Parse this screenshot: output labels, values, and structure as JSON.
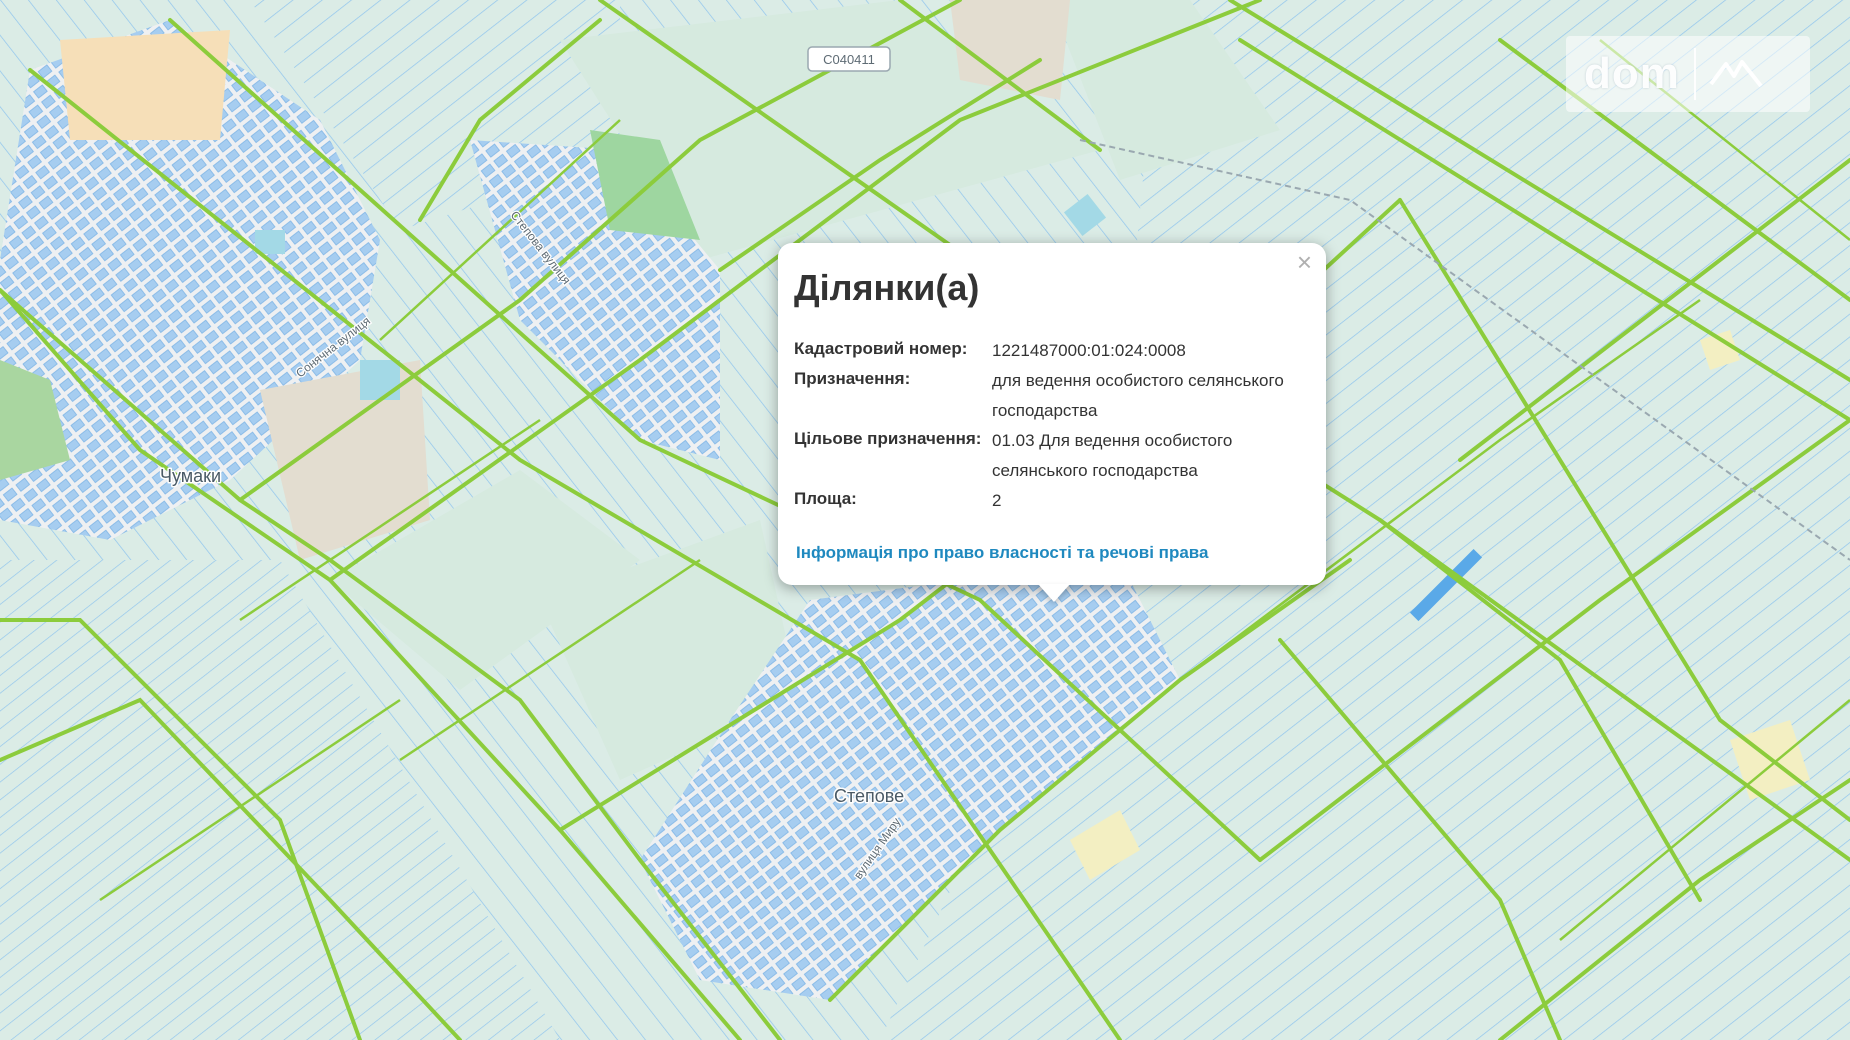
{
  "map": {
    "place_labels": [
      "Чумаки",
      "Степове"
    ],
    "street_labels": [
      "Сонячна вулиця",
      "Степова вулиця",
      "вулиця Миру"
    ],
    "road_shield": "С040411",
    "colors": {
      "background": "#dbece6",
      "parcel_outline": "#8fc4ee",
      "road_green": "#8ccc3c",
      "settlement": "#eef0f2",
      "village_block": "#a6cdf0"
    }
  },
  "watermark": {
    "text": "dom",
    "icon": "ria-logo-icon"
  },
  "popup": {
    "title": "Ділянки(а)",
    "close": "×",
    "fields": [
      {
        "label": "Кадастровий номер:",
        "value": "1221487000:01:024:0008"
      },
      {
        "label": "Призначення:",
        "value": "для ведення особистого селянського господарства"
      },
      {
        "label": "Цільове призначення:",
        "value": "01.03 Для ведення особистого селянського господарства"
      },
      {
        "label": "Площа:",
        "value": "2"
      }
    ],
    "link": "Інформація про право власності та речові права"
  }
}
